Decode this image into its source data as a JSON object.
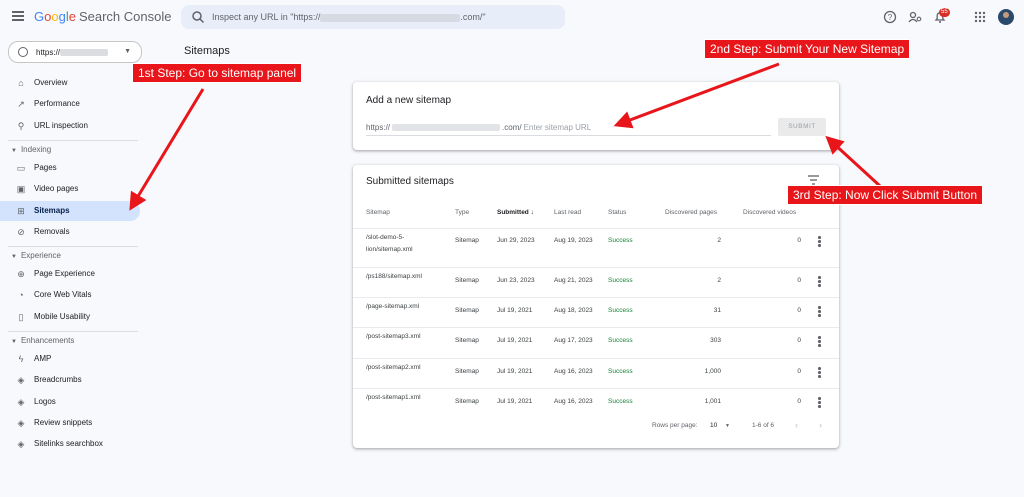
{
  "header": {
    "logo": {
      "g1": "G",
      "g2": "o",
      "g3": "o",
      "g4": "g",
      "g5": "l",
      "g6": "e",
      "product": "Search Console"
    },
    "search_prefix": "Inspect any URL in \"https://",
    "search_suffix": ".com/\"",
    "notification_count": "55"
  },
  "property": {
    "prefix": "https://"
  },
  "sidebar": {
    "top_items": [
      {
        "label": "Overview",
        "icon": "home-icon"
      },
      {
        "label": "Performance",
        "icon": "trending-icon"
      },
      {
        "label": "URL inspection",
        "icon": "search-icon"
      }
    ],
    "sections": [
      {
        "title": "Indexing",
        "items": [
          {
            "label": "Pages",
            "icon": "pages-icon"
          },
          {
            "label": "Video pages",
            "icon": "video-icon"
          },
          {
            "label": "Sitemaps",
            "icon": "sitemap-icon",
            "active": true
          },
          {
            "label": "Removals",
            "icon": "removals-icon"
          }
        ]
      },
      {
        "title": "Experience",
        "items": [
          {
            "label": "Page Experience",
            "icon": "plus-icon"
          },
          {
            "label": "Core Web Vitals",
            "icon": "gauge-icon"
          },
          {
            "label": "Mobile Usability",
            "icon": "phone-icon"
          }
        ]
      },
      {
        "title": "Enhancements",
        "items": [
          {
            "label": "AMP",
            "icon": "bolt-icon"
          },
          {
            "label": "Breadcrumbs",
            "icon": "layers-icon"
          },
          {
            "label": "Logos",
            "icon": "layers-icon"
          },
          {
            "label": "Review snippets",
            "icon": "layers-icon"
          },
          {
            "label": "Sitelinks searchbox",
            "icon": "layers-icon"
          }
        ]
      }
    ]
  },
  "page": {
    "title": "Sitemaps"
  },
  "add_sitemap": {
    "title": "Add a new sitemap",
    "url_prefix": "https://",
    "url_suffix": ".com/",
    "placeholder": "Enter sitemap URL",
    "submit_label": "SUBMIT"
  },
  "submitted": {
    "title": "Submitted sitemaps",
    "columns": [
      "Sitemap",
      "Type",
      "Submitted",
      "Last read",
      "Status",
      "Discovered pages",
      "Discovered videos"
    ],
    "rows": [
      {
        "sitemap": "/slot-demo-5-lion/sitemap.xml",
        "type": "Sitemap",
        "submitted": "Jun 29, 2023",
        "last_read": "Aug 19, 2023",
        "status": "Success",
        "pages": "2",
        "videos": "0"
      },
      {
        "sitemap": "/ps188/sitemap.xml",
        "type": "Sitemap",
        "submitted": "Jun 23, 2023",
        "last_read": "Aug 21, 2023",
        "status": "Success",
        "pages": "2",
        "videos": "0"
      },
      {
        "sitemap": "/page-sitemap.xml",
        "type": "Sitemap",
        "submitted": "Jul 19, 2021",
        "last_read": "Aug 18, 2023",
        "status": "Success",
        "pages": "31",
        "videos": "0"
      },
      {
        "sitemap": "/post-sitemap3.xml",
        "type": "Sitemap",
        "submitted": "Jul 19, 2021",
        "last_read": "Aug 17, 2023",
        "status": "Success",
        "pages": "303",
        "videos": "0"
      },
      {
        "sitemap": "/post-sitemap2.xml",
        "type": "Sitemap",
        "submitted": "Jul 19, 2021",
        "last_read": "Aug 16, 2023",
        "status": "Success",
        "pages": "1,000",
        "videos": "0"
      },
      {
        "sitemap": "/post-sitemap1.xml",
        "type": "Sitemap",
        "submitted": "Jul 19, 2021",
        "last_read": "Aug 16, 2023",
        "status": "Success",
        "pages": "1,001",
        "videos": "0"
      }
    ],
    "rows_per_page_label": "Rows per page:",
    "rows_per_page": "10",
    "range": "1-6 of 6"
  },
  "annotations": {
    "step1": "1st Step: Go to sitemap panel",
    "step2": "2nd Step: Submit Your New Sitemap",
    "step3": "3rd Step: Now Click Submit Button"
  },
  "colors": {
    "accent": "#1a73e8",
    "active_nav": "#d3e3fd",
    "success": "#188038",
    "annotation": "#e8161a"
  }
}
